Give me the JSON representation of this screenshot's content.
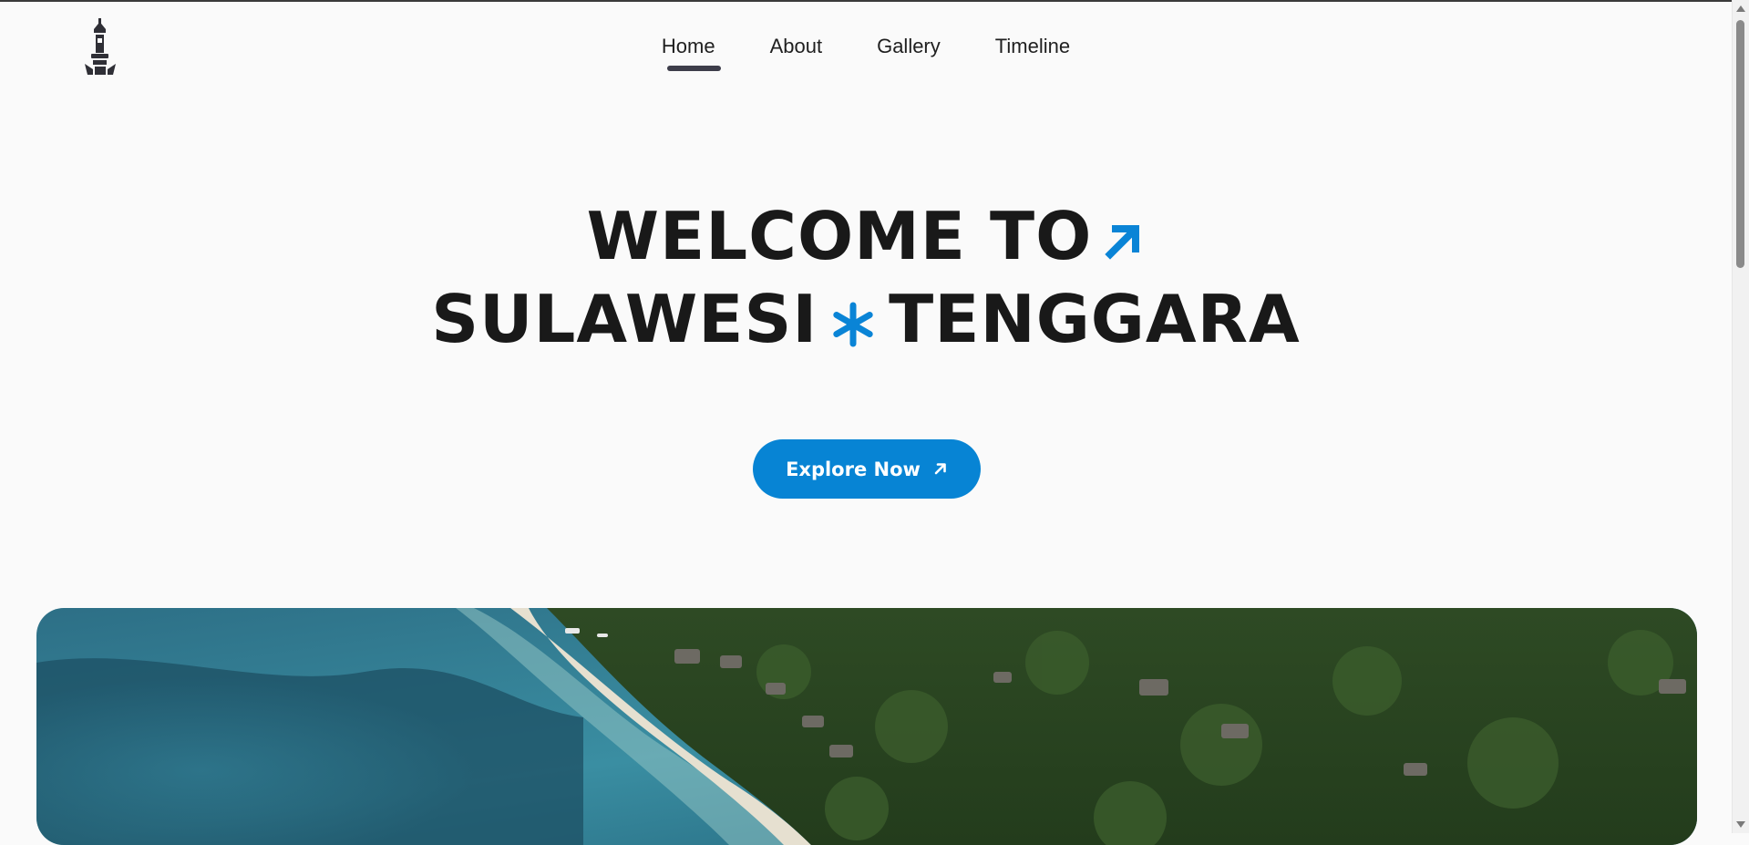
{
  "nav": {
    "items": [
      {
        "label": "Home",
        "active": true
      },
      {
        "label": "About",
        "active": false
      },
      {
        "label": "Gallery",
        "active": false
      },
      {
        "label": "Timeline",
        "active": false
      }
    ]
  },
  "hero": {
    "line1": "WELCOME TO",
    "line2_left": "SULAWESI",
    "line2_right": "TENGGARA",
    "arrow_icon": "arrow-up-right-icon",
    "star_icon": "asterisk-icon",
    "accent_color": "#0a84d6"
  },
  "cta": {
    "label": "Explore Now",
    "icon": "arrow-up-right-icon",
    "color": "#0784d4"
  },
  "logo": {
    "icon": "tugu-monument-icon"
  },
  "photo": {
    "alt_icon": "aerial-island-photo"
  }
}
